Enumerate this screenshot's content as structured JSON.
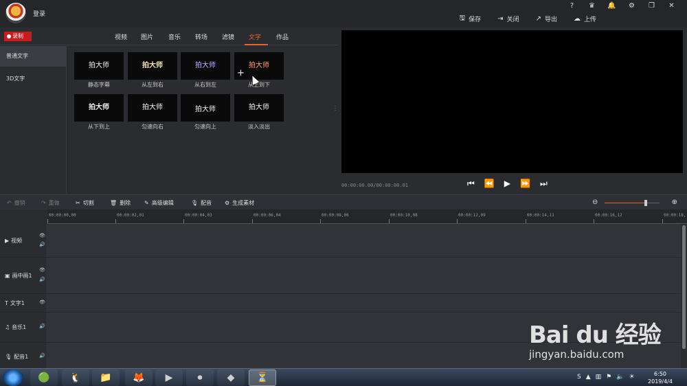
{
  "titlebar": {
    "login": "登录",
    "help": "?",
    "vip": "VIP",
    "actions": [
      {
        "icon": "save-icon",
        "label": "保存"
      },
      {
        "icon": "close-project-icon",
        "label": "关闭"
      },
      {
        "icon": "export-icon",
        "label": "导出"
      },
      {
        "icon": "upload-icon",
        "label": "上传"
      }
    ]
  },
  "tabs": {
    "record": "录制",
    "items": [
      "视频",
      "图片",
      "音乐",
      "转场",
      "滤镜",
      "文字",
      "作品"
    ],
    "active": "文字"
  },
  "sidebar": {
    "items": [
      "普通文字",
      "3D文字"
    ],
    "active": "普通文字"
  },
  "text_presets": [
    {
      "thumb": "拍大师",
      "label": "静态字幕"
    },
    {
      "thumb": "拍大师",
      "label": "从左到右"
    },
    {
      "thumb": "拍大师",
      "label": "从右到左"
    },
    {
      "thumb": "拍大师",
      "label": "从上到下"
    },
    {
      "thumb": "拍大师",
      "label": "从下到上"
    },
    {
      "thumb": "拍大师",
      "label": "匀速向右"
    },
    {
      "thumb": "拍大师",
      "label": "匀速向上"
    },
    {
      "thumb": "拍大师",
      "label": "淡入淡出"
    }
  ],
  "preview": {
    "timecode": "00:00:00.00/00:00:00.01"
  },
  "toolbar": {
    "undo": "撤销",
    "redo": "重做",
    "cut": "切割",
    "delete": "删除",
    "advanced_edit": "高级编辑",
    "dub": "配音",
    "generate": "生成素材",
    "zoom_level": 0.75
  },
  "timeline": {
    "ticks": [
      "00:00:00,00",
      "00:00:02,01",
      "00:00:04,03",
      "00:00:06,04",
      "00:00:08,06",
      "00:00:10,08",
      "00:00:12,09",
      "00:00:14,11",
      "00:00:16,12",
      "00:00:18,"
    ],
    "tracks": [
      {
        "icon": "video-track-icon",
        "label": "视频"
      },
      {
        "icon": "pip-track-icon",
        "label": "画中画1"
      },
      {
        "icon": "text-track-icon",
        "label": "文字1"
      },
      {
        "icon": "music-track-icon",
        "label": "音乐1"
      },
      {
        "icon": "mic-track-icon",
        "label": "配音1"
      }
    ]
  },
  "watermark": {
    "brand": "Bai du 经验",
    "url": "jingyan.baidu.com"
  },
  "taskbar": {
    "time": "6:50",
    "date": "2019/4/4"
  }
}
